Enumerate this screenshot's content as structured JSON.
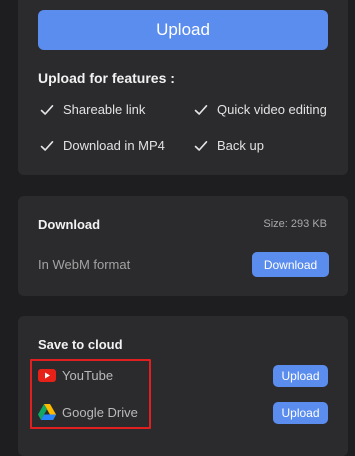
{
  "upload_card": {
    "upload_button": "Upload",
    "features_title": "Upload for features :",
    "features": [
      "Shareable link",
      "Quick video editing",
      "Download in MP4",
      "Back up"
    ]
  },
  "download_card": {
    "title": "Download",
    "size": "Size: 293 KB",
    "format": "In WebM format",
    "button": "Download"
  },
  "cloud_card": {
    "title": "Save to cloud",
    "services": [
      {
        "name": "YouTube",
        "icon": "youtube-icon",
        "button": "Upload"
      },
      {
        "name": "Google Drive",
        "icon": "google-drive-icon",
        "button": "Upload"
      }
    ]
  },
  "colors": {
    "accent": "#5b8def",
    "background": "#1e1e20",
    "card": "#2b2b2e",
    "highlight": "#e02020"
  }
}
